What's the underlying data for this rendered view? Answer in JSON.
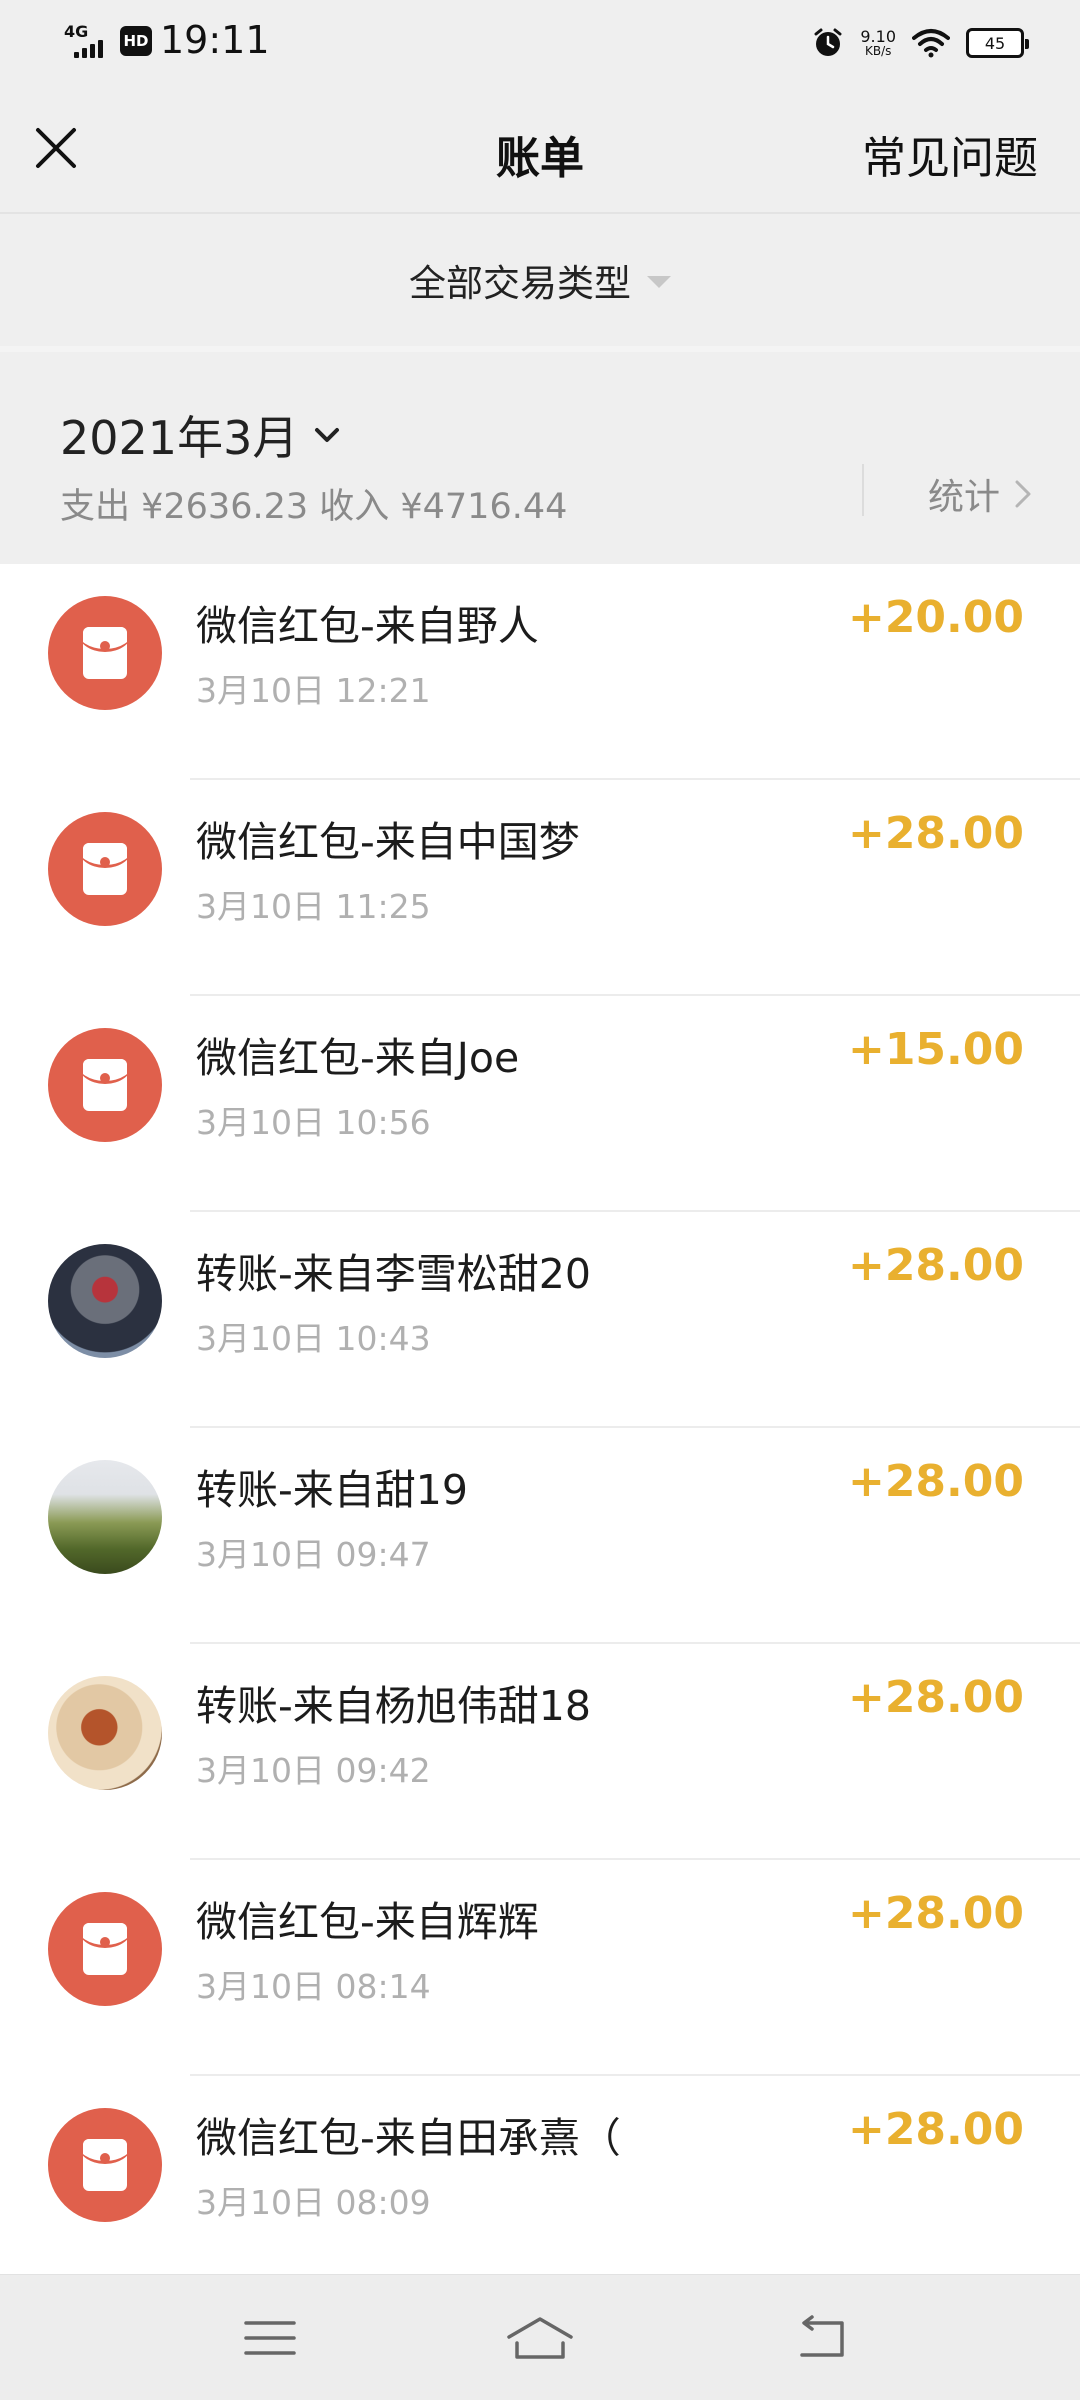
{
  "status_bar": {
    "network": "4G",
    "hd_badge": "HD",
    "time": "19:11",
    "speed_value": "9.10",
    "speed_unit": "KB/s",
    "battery": "45"
  },
  "nav": {
    "title": "账单",
    "faq_label": "常见问题"
  },
  "filter": {
    "label": "全部交易类型"
  },
  "summary": {
    "month": "2021年3月",
    "totals": "支出 ¥2636.23 收入 ¥4716.44",
    "stats_label": "统计"
  },
  "transactions": [
    {
      "title": "微信红包-来自野人",
      "time": "3月10日 12:21",
      "amount": "+20.00",
      "avatar": "red-packet"
    },
    {
      "title": "微信红包-来自中国梦",
      "time": "3月10日 11:25",
      "amount": "+28.00",
      "avatar": "red-packet"
    },
    {
      "title": "微信红包-来自Joe",
      "time": "3月10日 10:56",
      "amount": "+15.00",
      "avatar": "red-packet"
    },
    {
      "title": "转账-来自李雪松甜20",
      "time": "3月10日 10:43",
      "amount": "+28.00",
      "avatar": "photo"
    },
    {
      "title": "转账-来自甜19",
      "time": "3月10日 09:47",
      "amount": "+28.00",
      "avatar": "photo"
    },
    {
      "title": "转账-来自杨旭伟甜18",
      "time": "3月10日 09:42",
      "amount": "+28.00",
      "avatar": "photo"
    },
    {
      "title": "微信红包-来自辉辉",
      "time": "3月10日 08:14",
      "amount": "+28.00",
      "avatar": "red-packet"
    },
    {
      "title": "微信红包-来自田承熹（",
      "time": "3月10日 08:09",
      "amount": "+28.00",
      "avatar": "red-packet"
    }
  ],
  "colors": {
    "amount": "#e9b02f",
    "red_packet": "#e0604c",
    "header_bg": "#efefef"
  },
  "bottom_nav": {
    "icons": [
      "menu-icon",
      "home-icon",
      "back-icon"
    ]
  }
}
